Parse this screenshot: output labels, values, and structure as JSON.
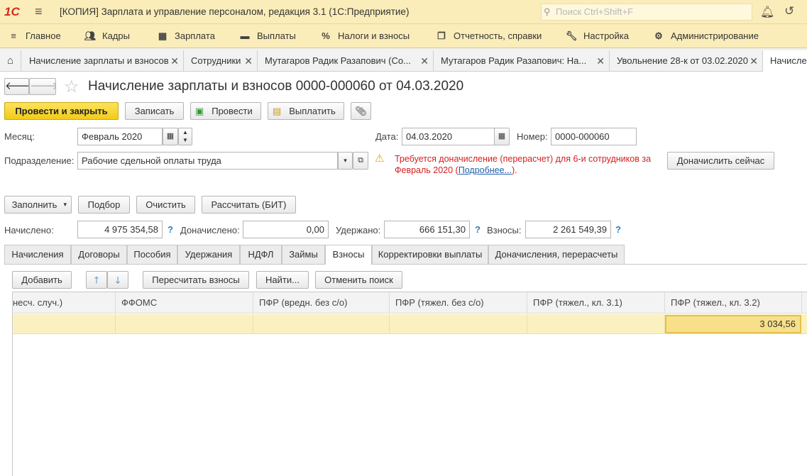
{
  "titlebar": {
    "logo": "1С",
    "title": "[КОПИЯ] Зарплата и управление персоналом, редакция 3.1  (1С:Предприятие)",
    "search_placeholder": "Поиск Ctrl+Shift+F"
  },
  "menu": {
    "items": [
      {
        "label": "Главное",
        "icon": "≡"
      },
      {
        "label": "Кадры",
        "icon": "people-icon"
      },
      {
        "label": "Зарплата",
        "icon": "calculator-icon"
      },
      {
        "label": "Выплаты",
        "icon": "wallet-icon"
      },
      {
        "label": "Налоги и взносы",
        "icon": "percent-icon"
      },
      {
        "label": "Отчетность, справки",
        "icon": "reports-icon"
      },
      {
        "label": "Настройка",
        "icon": "wrench-icon"
      },
      {
        "label": "Администрирование",
        "icon": "gear-icon"
      }
    ]
  },
  "tabs": [
    {
      "label": "Начисление зарплаты и взносов"
    },
    {
      "label": "Сотрудники"
    },
    {
      "label": "Мутагаров Радик Разапович (Со..."
    },
    {
      "label": "Мутагаров Радик Разапович: На..."
    },
    {
      "label": "Увольнение 28-к от 03.02.2020"
    },
    {
      "label": "Начисле"
    }
  ],
  "form": {
    "title": "Начисление зарплаты и взносов 0000-000060 от 04.03.2020",
    "buttons": {
      "post_close": "Провести и закрыть",
      "save": "Записать",
      "post": "Провести",
      "pay": "Выплатить"
    },
    "month_label": "Месяц:",
    "month_value": "Февраль 2020",
    "date_label": "Дата:",
    "date_value": "04.03.2020",
    "number_label": "Номер:",
    "number_value": "0000-000060",
    "dept_label": "Подразделение:",
    "dept_value": "Рабочие сдельной оплаты труда",
    "warning_text": "Требуется доначисление (перерасчет) для 6-и сотрудников за Февраль 2020 (",
    "warning_link": "Подробнее...",
    "warning_end": ").",
    "recalc_now": "Доначислить сейчас",
    "fill": "Заполнить",
    "pick": "Подбор",
    "clear": "Очистить",
    "calc": "Рассчитать (БИТ)",
    "accrued_label": "Начислено:",
    "accrued_value": "4 975 354,58",
    "extra_label": "Доначислено:",
    "extra_value": "0,00",
    "withheld_label": "Удержано:",
    "withheld_value": "666 151,30",
    "contrib_label": "Взносы:",
    "contrib_value": "2 261 549,39",
    "help": "?"
  },
  "subtabs": [
    "Начисления",
    "Договоры",
    "Пособия",
    "Удержания",
    "НДФЛ",
    "Займы",
    "Взносы",
    "Корректировки выплаты",
    "Доначисления, перерасчеты"
  ],
  "table_toolbar": {
    "add": "Добавить",
    "recalc": "Пересчитать взносы",
    "find": "Найти...",
    "cancel_search": "Отменить поиск"
  },
  "table": {
    "columns": [
      "несч. случ.)",
      "ФФОМС",
      "ПФР (вредн. без с/о)",
      "ПФР (тяжел. без с/о)",
      "ПФР (тяжел.,  кл. 3.1)",
      "ПФР (тяжел.,  кл. 3.2)"
    ],
    "rows": [
      [
        "",
        "",
        "",
        "",
        "",
        "3 034,56"
      ]
    ]
  }
}
